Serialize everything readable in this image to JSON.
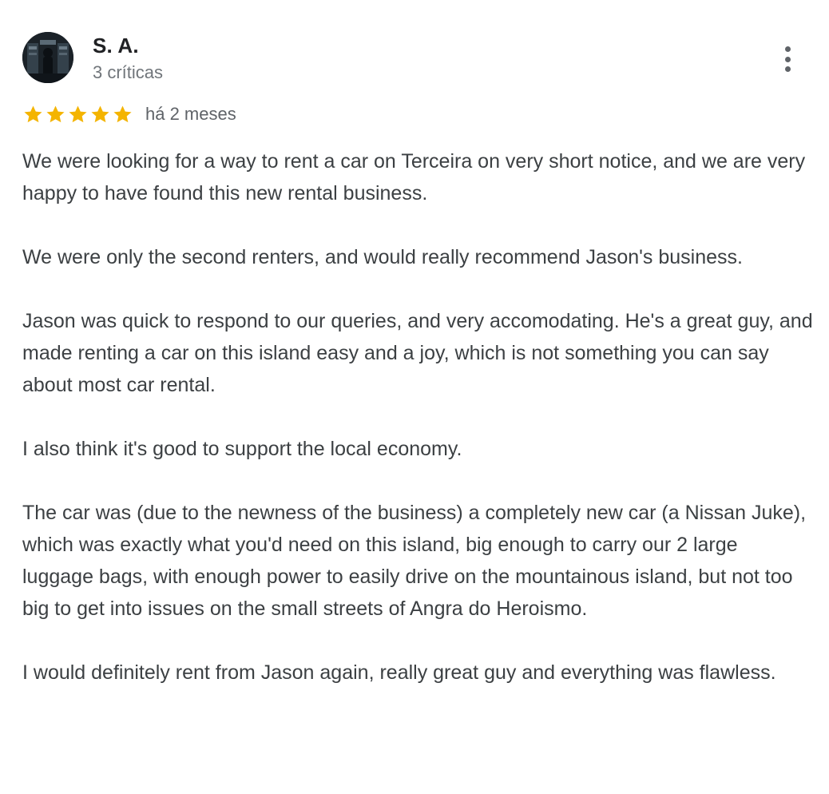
{
  "review": {
    "author": {
      "name": "S. A.",
      "meta": "3 críticas",
      "avatar_icon": "profile-photo"
    },
    "rating": {
      "stars": 5,
      "max": 5,
      "color": "#f4b400"
    },
    "date": "há 2 meses",
    "menu_icon": "more-vert-icon",
    "paragraphs": [
      "We were looking for a way to rent a car on Terceira on very short notice, and we are very happy to have found this new rental business.",
      "We were only the second renters, and would really recommend Jason's business.",
      "Jason was quick to respond to our queries, and very accomodating. He's a great guy, and made renting a car on this island easy and a joy, which is not something you can say about most car rental.",
      "I also think it's good to support the local economy.",
      "The car was (due to the newness of the business) a completely new car (a Nissan Juke), which was exactly what you'd need on this island, big enough to carry our 2 large luggage bags, with enough power to easily drive on the mountainous island, but not too big to get into issues on the small streets of Angra do Heroismo.",
      "I would definitely rent from Jason again, really great guy and everything was flawless."
    ]
  }
}
